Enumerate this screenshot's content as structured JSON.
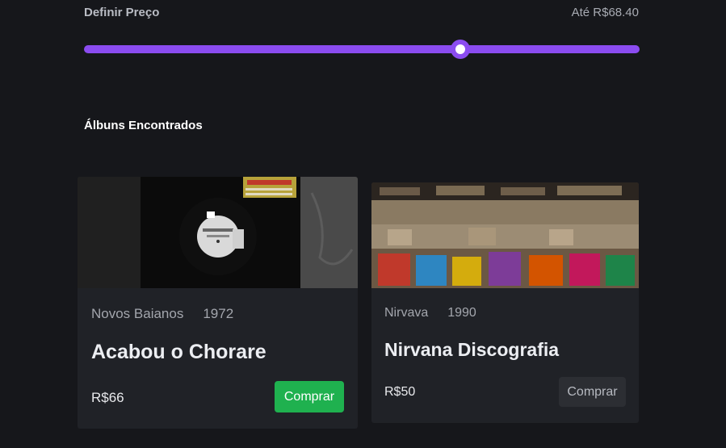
{
  "filter": {
    "label": "Definir Preço",
    "value_text": "Até R$68.40",
    "slider_fraction": 0.677,
    "accent_color": "#8b4cf0"
  },
  "results": {
    "title": "Álbuns Encontrados",
    "albums": [
      {
        "artist": "Novos Baianos",
        "year": "1972",
        "title": "Acabou o Chorare",
        "price": "R$66",
        "buy_label": "Comprar",
        "cover": "vinyl-record-photo",
        "button_state": "active",
        "button_color": "#1fb14f"
      },
      {
        "artist": "Nirvava",
        "year": "1990",
        "title": "Nirvana Discografia",
        "price": "R$50",
        "buy_label": "Comprar",
        "cover": "record-store-crates-photo",
        "button_state": "default",
        "button_color": "#2c2e33"
      }
    ]
  }
}
